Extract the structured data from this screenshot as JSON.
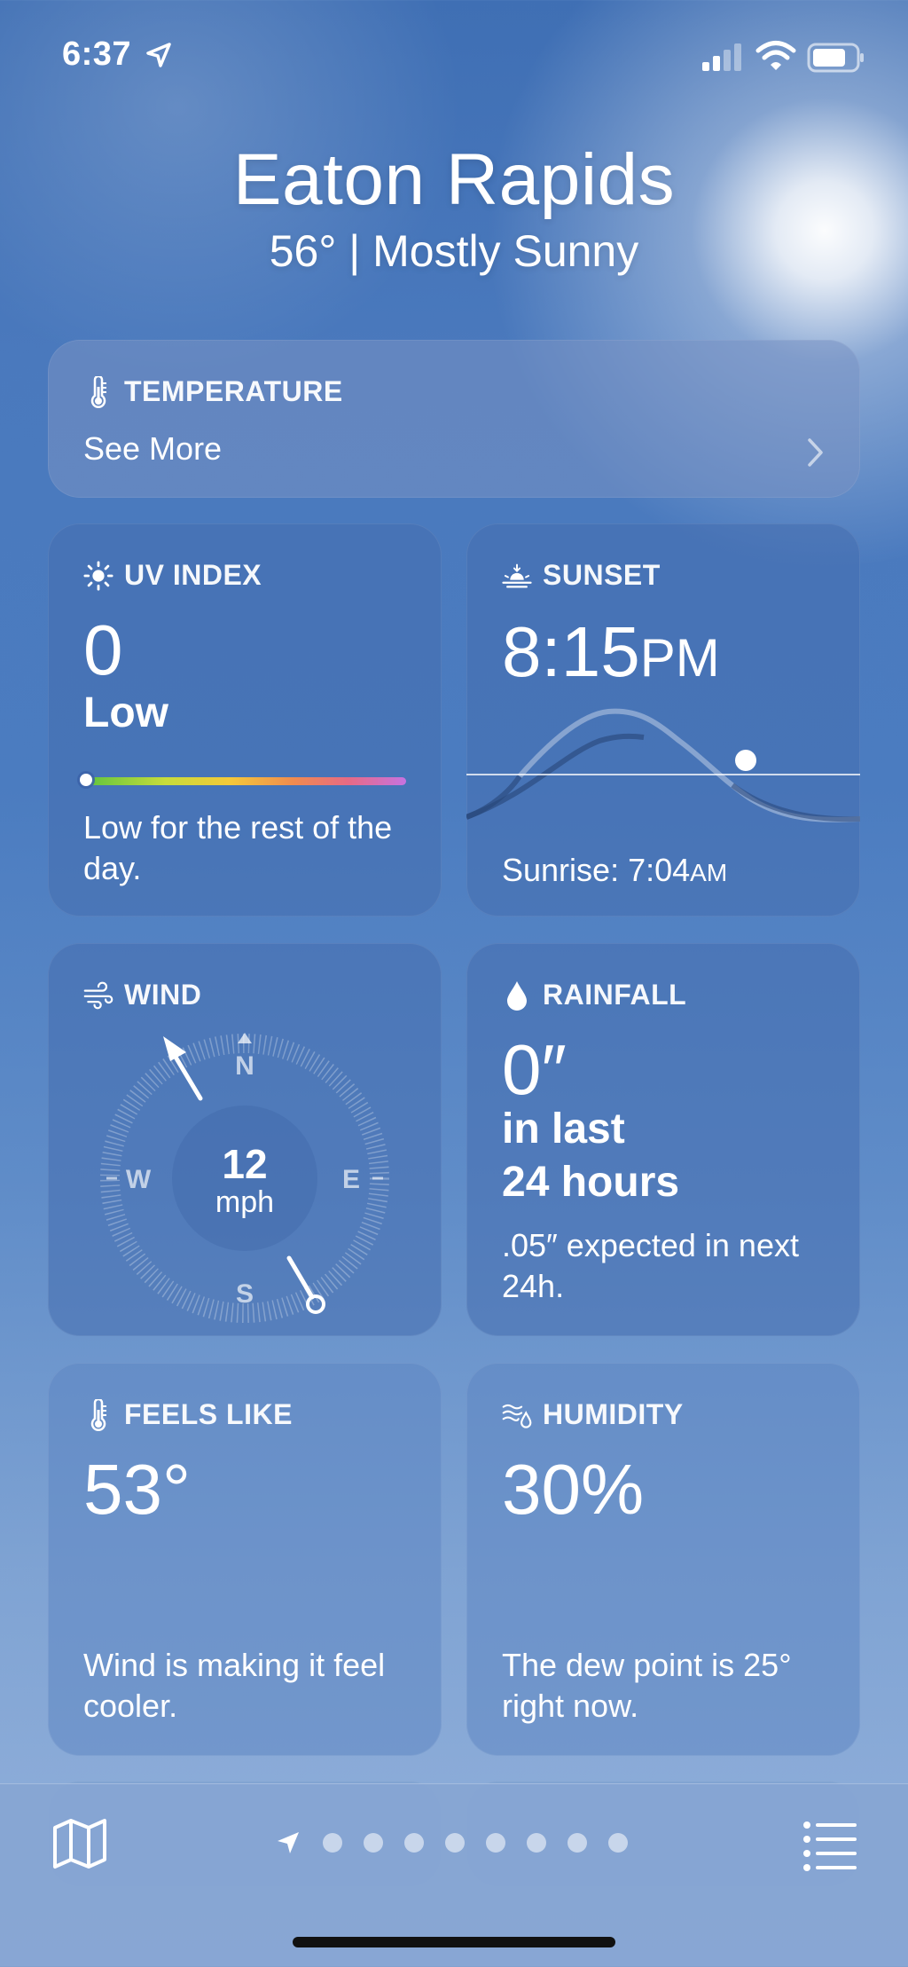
{
  "status_bar": {
    "time": "6:37",
    "icons": [
      "location-arrow-icon",
      "cellular-signal-icon",
      "wifi-icon",
      "battery-icon"
    ]
  },
  "header": {
    "city": "Eaton Rapids",
    "summary": "56°  |  Mostly Sunny"
  },
  "temperature_card": {
    "icon": "thermometer-icon",
    "title": "TEMPERATURE",
    "link": "See More"
  },
  "uv_card": {
    "icon": "sun-icon",
    "title": "UV INDEX",
    "value": "0",
    "level": "Low",
    "scale_position": 0,
    "description": "Low for the rest of the day."
  },
  "sunset_card": {
    "icon": "sunset-icon",
    "title": "SUNSET",
    "time": "8:15",
    "time_suffix": "PM",
    "sunrise_label": "Sunrise: 7:04",
    "sunrise_suffix": "AM"
  },
  "wind_card": {
    "icon": "wind-icon",
    "title": "WIND",
    "speed": "12",
    "unit": "mph",
    "compass": {
      "n": "N",
      "e": "E",
      "s": "S",
      "w": "W"
    }
  },
  "rainfall_card": {
    "icon": "raindrop-icon",
    "title": "RAINFALL",
    "value": "0″",
    "period_line1": "in last",
    "period_line2": "24 hours",
    "description": ".05″ expected in next 24h."
  },
  "feels_like_card": {
    "icon": "thermometer-icon",
    "title": "FEELS LIKE",
    "value": "53°",
    "description": "Wind is making it feel cooler."
  },
  "humidity_card": {
    "icon": "humidity-icon",
    "title": "HUMIDITY",
    "value": "30%",
    "description": "The dew point is 25° right now."
  },
  "tab_bar": {
    "page_count": 9,
    "current_page": 1,
    "buttons": [
      "map-icon",
      "location-arrow-icon",
      "list-icon"
    ]
  },
  "colors": {
    "sky_top": "#3f6fb4",
    "sky_bottom": "#95b2dc",
    "card": "#466eaf"
  }
}
